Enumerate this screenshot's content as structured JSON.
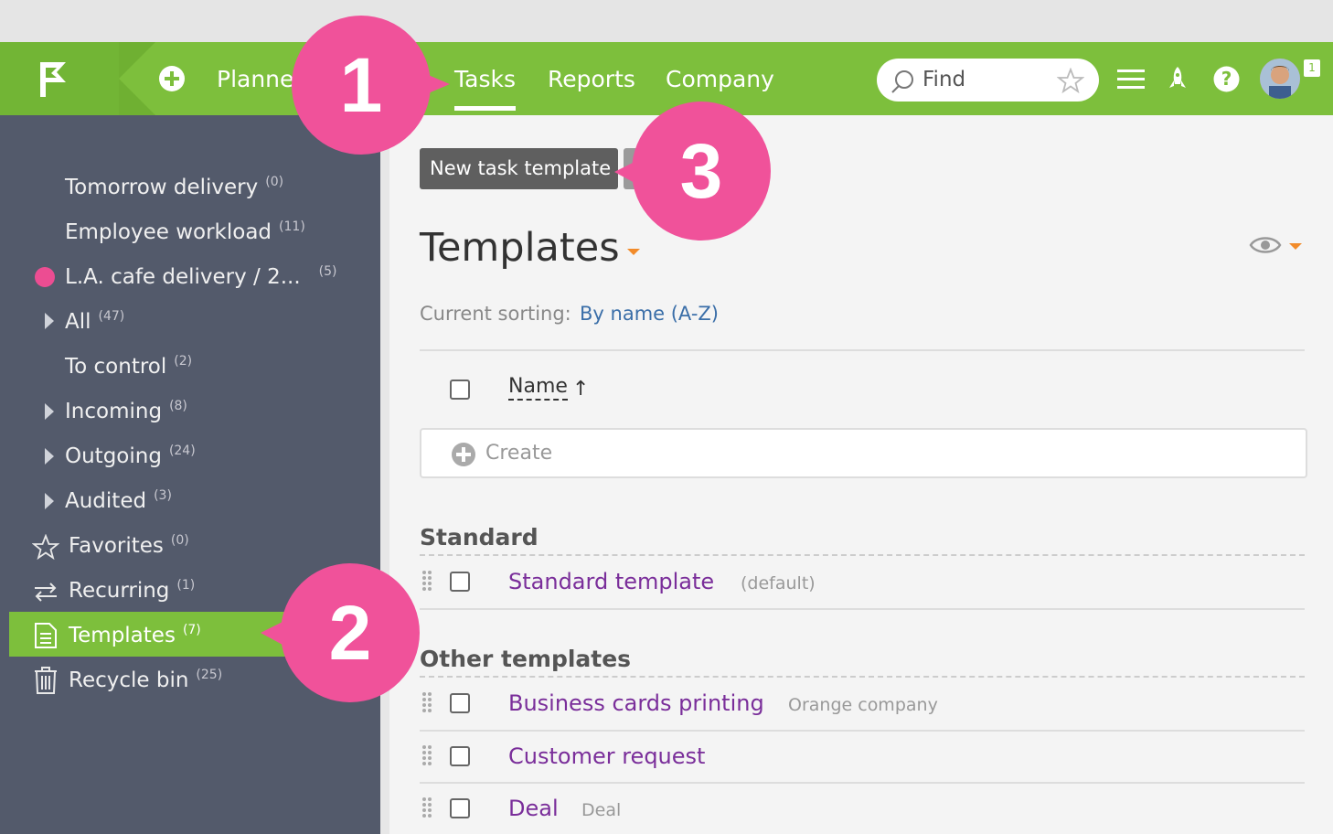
{
  "nav": {
    "items": [
      "Planne",
      "Tasks",
      "Reports",
      "Company"
    ],
    "active": "Tasks",
    "search_placeholder": "Find",
    "notification_count": "1"
  },
  "sidebar": {
    "items": [
      {
        "label": "Tomorrow delivery",
        "count": "(0)"
      },
      {
        "label": "Employee workload",
        "count": "(11)"
      },
      {
        "label": "L.A. cafe delivery / 2...",
        "count": "(5)"
      },
      {
        "label": "All",
        "count": "(47)"
      },
      {
        "label": "To control",
        "count": "(2)"
      },
      {
        "label": "Incoming",
        "count": "(8)"
      },
      {
        "label": "Outgoing",
        "count": "(24)"
      },
      {
        "label": "Audited",
        "count": "(3)"
      },
      {
        "label": "Favorites",
        "count": "(0)"
      },
      {
        "label": "Recurring",
        "count": "(1)"
      },
      {
        "label": "Templates",
        "count": "(7)"
      },
      {
        "label": "Recycle bin",
        "count": "(25)"
      }
    ],
    "active": "Templates"
  },
  "main": {
    "new_button": "New task template",
    "title": "Templates",
    "sorting_label": "Current sorting:",
    "sorting_value": "By name (A-Z)",
    "column_name": "Name",
    "sort_arrow": "↑",
    "create_label": "Create",
    "sections": [
      {
        "title": "Standard",
        "rows": [
          {
            "name": "Standard template",
            "note": "(default)"
          }
        ]
      },
      {
        "title": "Other templates",
        "rows": [
          {
            "name": "Business cards printing",
            "note": "Orange company"
          },
          {
            "name": "Customer request",
            "note": ""
          },
          {
            "name": "Deal",
            "note": "Deal"
          }
        ]
      }
    ]
  },
  "callouts": [
    "1",
    "2",
    "3"
  ],
  "colors": {
    "brand_green": "#7dbf3c",
    "sidebar": "#535a6b",
    "callout": "#f0529a",
    "link": "#7a2e9a"
  }
}
